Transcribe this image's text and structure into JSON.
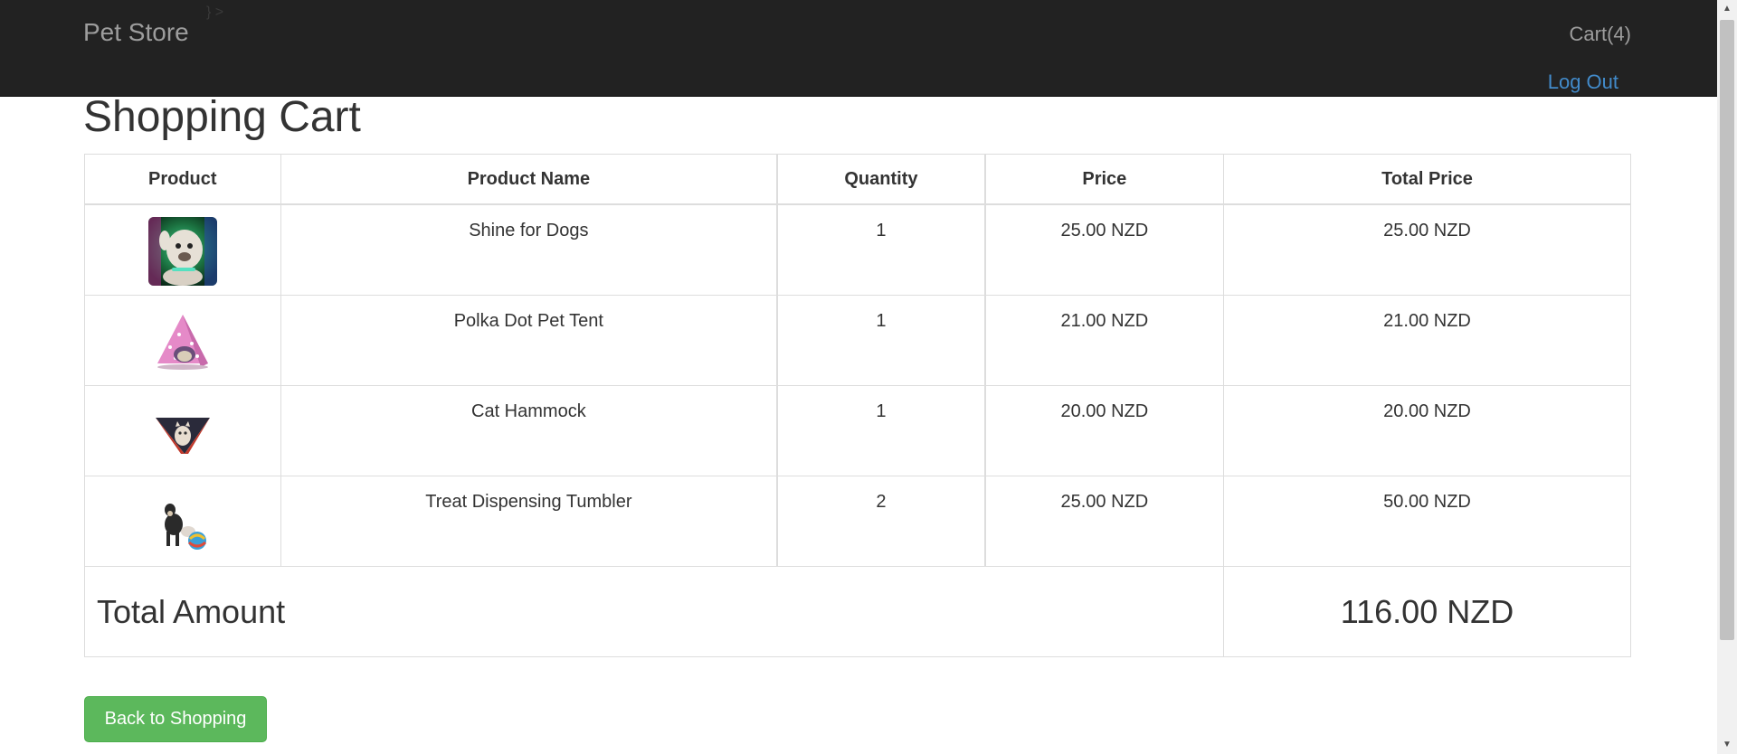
{
  "navbar": {
    "brand": "Pet Store",
    "stray_text": "} >",
    "cart_link": "Cart(4)",
    "logout_link": "Log Out",
    "link_color": "#428bca"
  },
  "page": {
    "title": "Shopping Cart"
  },
  "table": {
    "headers": [
      "Product",
      "Product Name",
      "Quantity",
      "Price",
      "Total Price"
    ],
    "rows": [
      {
        "image": "bulldog-product-image",
        "name": "Shine for Dogs",
        "quantity": "1",
        "price": "25.00 NZD",
        "total": "25.00 NZD"
      },
      {
        "image": "pink-pet-tent-image",
        "name": "Polka Dot Pet Tent",
        "quantity": "1",
        "price": "21.00 NZD",
        "total": "21.00 NZD"
      },
      {
        "image": "cat-hammock-image",
        "name": "Cat Hammock",
        "quantity": "1",
        "price": "20.00 NZD",
        "total": "20.00 NZD"
      },
      {
        "image": "dog-tumbler-image",
        "name": "Treat Dispensing Tumbler",
        "quantity": "2",
        "price": "25.00 NZD",
        "total": "50.00 NZD"
      }
    ],
    "total_label": "Total Amount",
    "total_value": "116.00 NZD"
  },
  "actions": {
    "back_button": "Back to Shopping",
    "button_color": "#5cb85c"
  },
  "icons": {
    "scroll_up": "▲",
    "scroll_down": "▼"
  }
}
